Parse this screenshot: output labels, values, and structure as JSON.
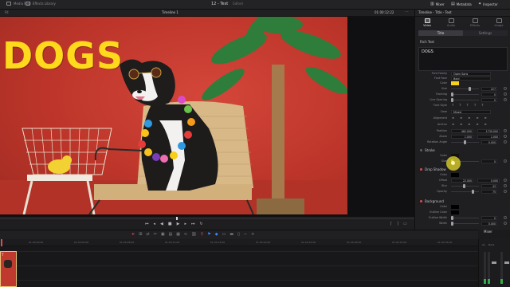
{
  "topbar": {
    "media_pool": "Media Pool",
    "library": "Effects Library",
    "project_title": "12 - Test",
    "edited": "Edited",
    "mixer": "Mixer",
    "metadata": "Metadata",
    "inspector": "Inspector"
  },
  "viewer": {
    "zoom": "Fit",
    "timeline_name": "Timeline 1",
    "timecode": "01:00:12:22",
    "title_text": "DOGS"
  },
  "inspector": {
    "header": "Timeline - Title - Text",
    "tabs": [
      "Video",
      "Audio",
      "Effects",
      "Transition",
      "Image",
      "File"
    ],
    "subtabs": [
      "Title",
      "Settings"
    ],
    "rich_text_label": "Rich Text",
    "rich_text_value": "DOGS",
    "fields": {
      "font_family_label": "Font Family",
      "font_family": "Open Sans",
      "font_face_label": "Font Face",
      "font_face": "Bold",
      "color_label": "Color",
      "color": "#f4d21a",
      "size_label": "Size",
      "size": "227",
      "tracking_label": "Tracking",
      "tracking": "0",
      "line_spacing_label": "Line Spacing",
      "line_spacing": "0",
      "font_style_label": "Font Style",
      "font_style_icons": "T T T T T",
      "case_label": "Case",
      "case_value": "Mixed",
      "alignment_label": "Alignment",
      "alignment_icons": "≡ ≡ ≡ ≡ ≡",
      "anchor_label": "Anchor",
      "anchor_icons": "≡ ≡ ≡ ≡ ≡",
      "position_label": "Position",
      "position_x": "462.000",
      "position_y": "1730.000",
      "zoom_label": "Zoom",
      "zoom_x": "1.000",
      "zoom_y": "1.000",
      "rotation_label": "Rotation Angle",
      "rotation": "0.000"
    },
    "stroke": {
      "title": "Stroke",
      "color_label": "Color",
      "size_label": "Size",
      "size": "0"
    },
    "drop_shadow": {
      "title": "Drop Shadow",
      "color_label": "Color",
      "offset_label": "Offset",
      "offset_x": "22.000",
      "offset_y": "0.000",
      "blur_label": "Blur",
      "blur": "43",
      "opacity_label": "Opacity",
      "opacity": "75"
    },
    "background": {
      "title": "Background",
      "color_label": "Color",
      "outline_color_label": "Outline Color",
      "outline_width_label": "Outline Width",
      "outline_width": "0",
      "width_label": "Width",
      "width": "0.000"
    }
  },
  "timeline": {
    "ticks": [
      "01:00:00:00",
      "01:00:04:00",
      "01:00:08:00",
      "01:00:12:00",
      "01:00:16:00",
      "01:00:20:00",
      "01:00:24:00",
      "01:00:28:00",
      "01:00:32:00",
      "01:00:36:00"
    ],
    "clip_label": "T"
  },
  "mixer": {
    "title": "Mixer",
    "a1": "A1",
    "bus1": "Bus1"
  }
}
